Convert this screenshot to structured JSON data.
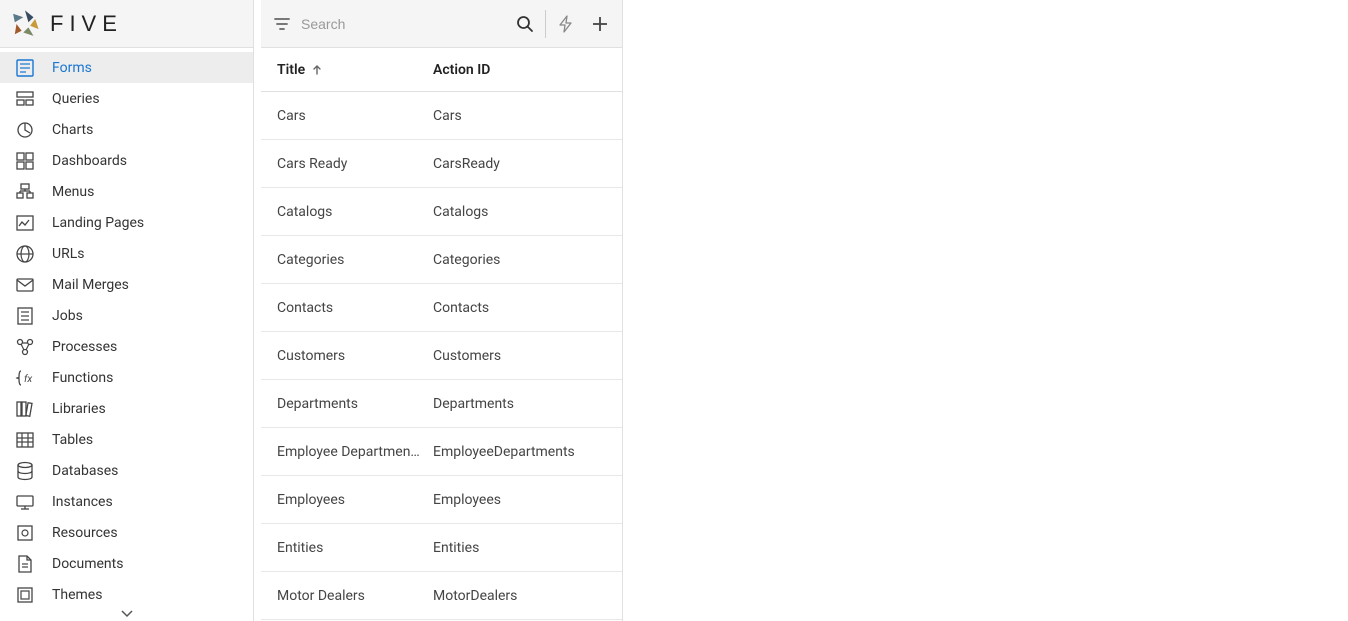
{
  "app": {
    "name": "FIVE"
  },
  "search": {
    "placeholder": "Search"
  },
  "sidebar": {
    "items": [
      {
        "label": "Forms",
        "icon": "forms",
        "active": true
      },
      {
        "label": "Queries",
        "icon": "queries"
      },
      {
        "label": "Charts",
        "icon": "charts"
      },
      {
        "label": "Dashboards",
        "icon": "dashboards"
      },
      {
        "label": "Menus",
        "icon": "menus"
      },
      {
        "label": "Landing Pages",
        "icon": "landing-pages"
      },
      {
        "label": "URLs",
        "icon": "urls"
      },
      {
        "label": "Mail Merges",
        "icon": "mail-merges"
      },
      {
        "label": "Jobs",
        "icon": "jobs"
      },
      {
        "label": "Processes",
        "icon": "processes"
      },
      {
        "label": "Functions",
        "icon": "functions"
      },
      {
        "label": "Libraries",
        "icon": "libraries"
      },
      {
        "label": "Tables",
        "icon": "tables"
      },
      {
        "label": "Databases",
        "icon": "databases"
      },
      {
        "label": "Instances",
        "icon": "instances"
      },
      {
        "label": "Resources",
        "icon": "resources"
      },
      {
        "label": "Documents",
        "icon": "documents"
      },
      {
        "label": "Themes",
        "icon": "themes"
      }
    ]
  },
  "table": {
    "columns": {
      "title": "Title",
      "action_id": "Action ID"
    },
    "rows": [
      {
        "title": "Cars",
        "action_id": "Cars"
      },
      {
        "title": "Cars Ready",
        "action_id": "CarsReady"
      },
      {
        "title": "Catalogs",
        "action_id": "Catalogs"
      },
      {
        "title": "Categories",
        "action_id": "Categories"
      },
      {
        "title": "Contacts",
        "action_id": "Contacts"
      },
      {
        "title": "Customers",
        "action_id": "Customers"
      },
      {
        "title": "Departments",
        "action_id": "Departments"
      },
      {
        "title": "Employee Departmen…",
        "action_id": "EmployeeDepartments"
      },
      {
        "title": "Employees",
        "action_id": "Employees"
      },
      {
        "title": "Entities",
        "action_id": "Entities"
      },
      {
        "title": "Motor Dealers",
        "action_id": "MotorDealers"
      }
    ]
  }
}
